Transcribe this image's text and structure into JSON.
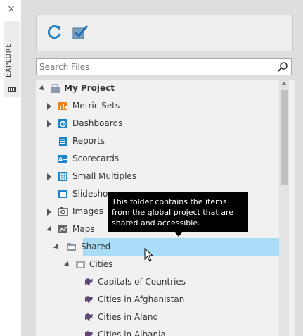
{
  "side_panel": {
    "close_glyph": "×",
    "tab_label": "EXPLORE"
  },
  "toolbar": {
    "refresh_icon": "refresh-icon",
    "check_icon": "checkbox-checked-icon"
  },
  "search": {
    "placeholder": "Search Files",
    "value": ""
  },
  "colors": {
    "accent_blue": "#1f82c9",
    "selection": "#a9dcf6",
    "tooltip_bg": "#000000",
    "metric_orange": "#e8821e"
  },
  "tree": {
    "items": [
      {
        "label": "My Project",
        "icon": "project-icon"
      },
      {
        "label": "Metric Sets",
        "icon": "metric-sets-icon"
      },
      {
        "label": "Dashboards",
        "icon": "dashboards-icon"
      },
      {
        "label": "Reports",
        "icon": "reports-icon"
      },
      {
        "label": "Scorecards",
        "icon": "scorecards-icon"
      },
      {
        "label": "Small Multiples",
        "icon": "small-multiples-icon"
      },
      {
        "label": "Slideshows",
        "icon": "slideshows-icon"
      },
      {
        "label": "Images",
        "icon": "images-icon"
      },
      {
        "label": "Maps",
        "icon": "maps-icon"
      },
      {
        "label": "Shared",
        "icon": "shared-folder-icon"
      },
      {
        "label": "Cities",
        "icon": "folder-icon"
      },
      {
        "label": "Capitals of Countries",
        "icon": "map-shape-icon"
      },
      {
        "label": "Cities in Afghanistan",
        "icon": "map-shape-icon"
      },
      {
        "label": "Cities in Aland",
        "icon": "map-shape-icon"
      },
      {
        "label": "Cities in Albania",
        "icon": "map-shape-icon"
      }
    ]
  },
  "tooltip": {
    "text": "This folder contains the items from the global project that are shared and accessible."
  }
}
